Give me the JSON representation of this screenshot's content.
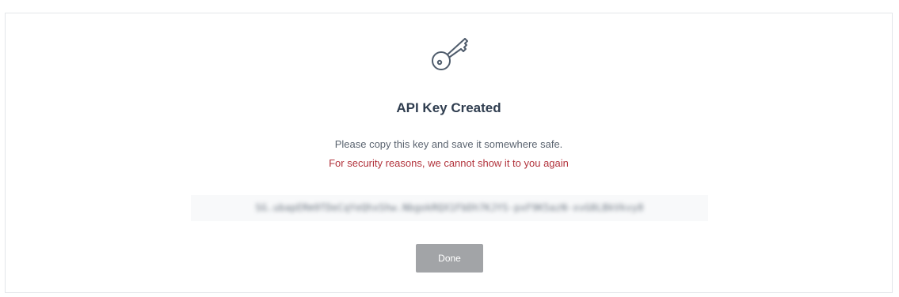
{
  "dialog": {
    "icon": "key-icon",
    "title": "API Key Created",
    "instruction": "Please copy this key and save it somewhere safe.",
    "warning": "For security reasons, we cannot show it to you again",
    "warning_color": "#b2333c",
    "api_key": "SG.ubapERm9TDeCqYeQhxShw.NbgokRQX1FbDh7KJYS-pxF9K5azN-xvG8LBkVkvy8",
    "done_label": "Done",
    "done_color": "#a2a4a7"
  }
}
